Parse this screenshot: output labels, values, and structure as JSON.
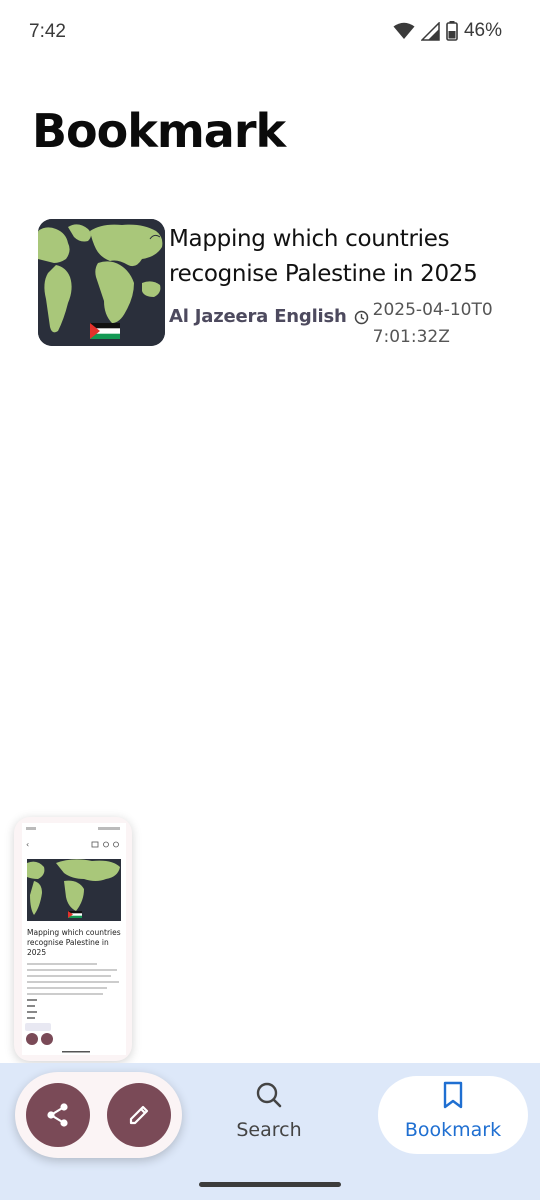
{
  "status_bar": {
    "time": "7:42",
    "battery": "46%"
  },
  "page": {
    "title": "Bookmark"
  },
  "bookmarks": [
    {
      "title": "Mapping which countries recognise Palestine in 2025",
      "source": "Al Jazeera English",
      "date": "2025-04-10T07:01:32Z"
    }
  ],
  "preview": {
    "title": "Mapping which countries recognise Palestine in 2025"
  },
  "bottom_nav": {
    "items": [
      {
        "label": "Search",
        "icon": "search-icon"
      },
      {
        "label": "Bookmark",
        "icon": "bookmark-icon",
        "active": true
      }
    ]
  },
  "fab": {
    "share_icon": "share-icon",
    "edit_icon": "pencil-icon"
  },
  "colors": {
    "nav_bg": "#dde8f9",
    "fab_bg": "#7a4a57",
    "active": "#1f6fd1"
  }
}
